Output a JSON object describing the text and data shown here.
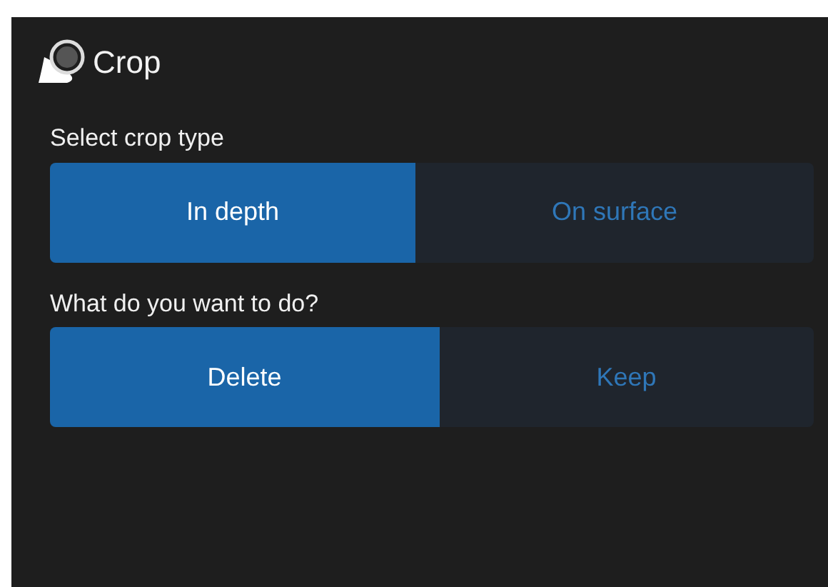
{
  "panel": {
    "title": "Crop"
  },
  "groups": [
    {
      "label": "Select crop type",
      "options": [
        {
          "label": "In depth",
          "selected": true
        },
        {
          "label": "On surface",
          "selected": false
        }
      ]
    },
    {
      "label": "What do you want to do?",
      "options": [
        {
          "label": "Delete",
          "selected": true
        },
        {
          "label": "Keep",
          "selected": false
        }
      ]
    }
  ]
}
